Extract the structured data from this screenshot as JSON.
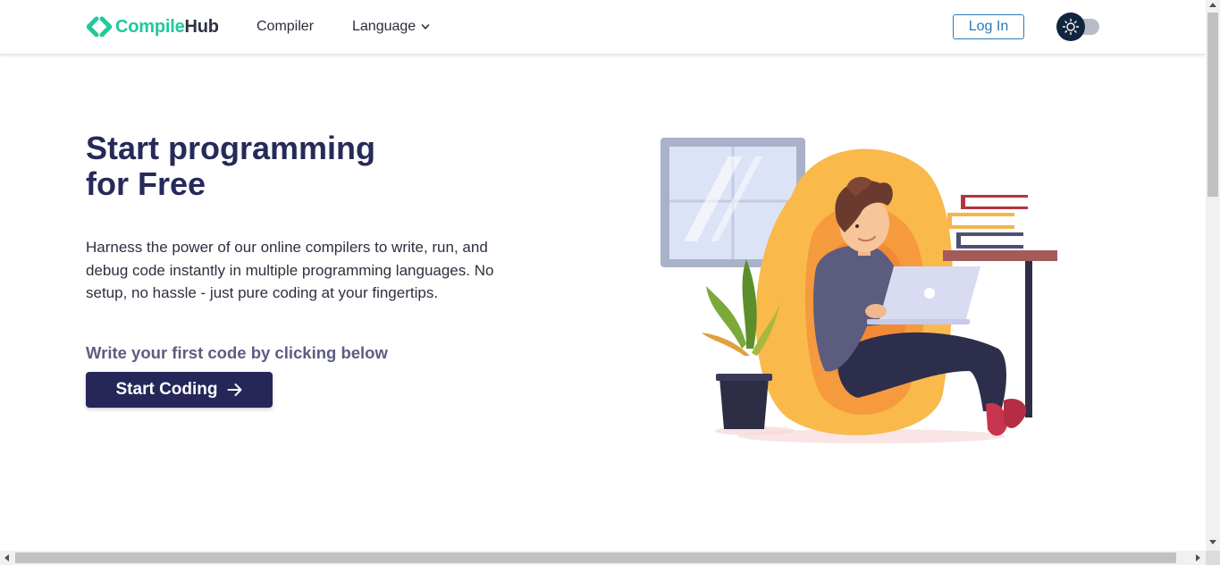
{
  "navbar": {
    "logo_part1": "Compile",
    "logo_part2": "Hub",
    "logo_icon": "code-brackets-icon",
    "links": [
      {
        "label": "Compiler"
      },
      {
        "label": "Language",
        "icon": "chevron-down-icon"
      }
    ],
    "login_label": "Log In",
    "theme_toggle": {
      "icon": "sun-icon",
      "state": "light"
    }
  },
  "hero": {
    "title_line1": "Start programming",
    "title_line2": "for Free",
    "description": "Harness the power of our online compilers to write, run, and debug code instantly in multiple programming languages. No setup, no hassle - just pure coding at your fingertips.",
    "subheading": "Write your first code by clicking below",
    "cta_label": "Start Coding",
    "cta_icon": "arrow-right-icon",
    "illustration": "person-coding-on-laptop-illustration"
  },
  "colors": {
    "brand_green": "#20c99a",
    "brand_dark": "#262659",
    "link_blue": "#2b7ab8",
    "toggle_dark": "#12253f"
  }
}
